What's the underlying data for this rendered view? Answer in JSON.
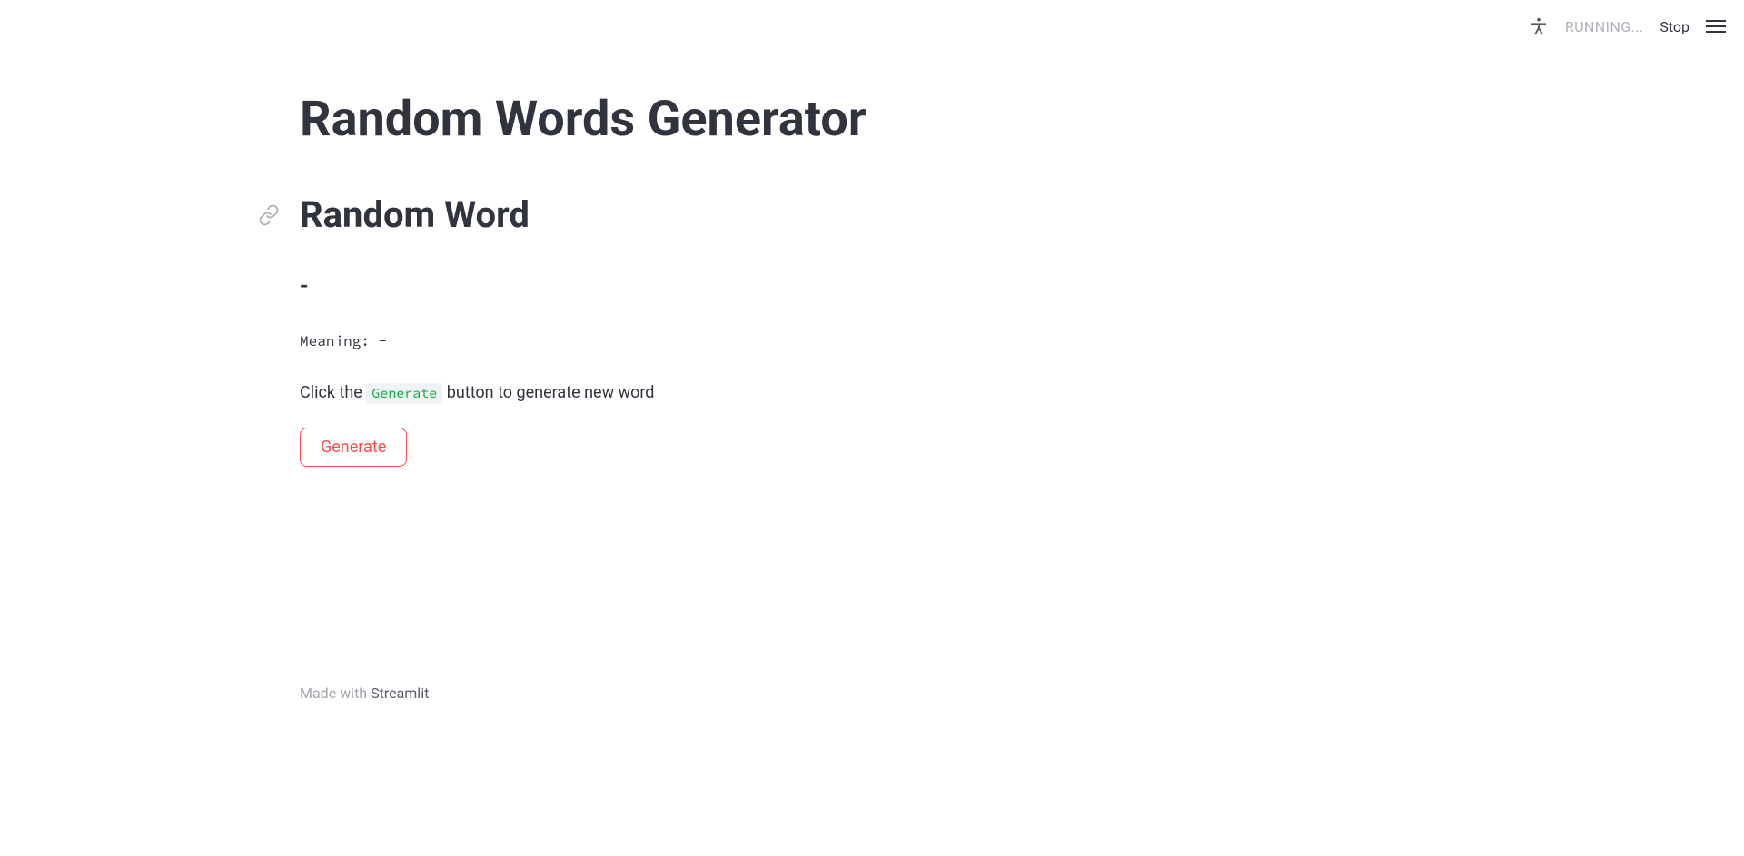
{
  "toolbar": {
    "running_label": "RUNNING...",
    "stop_label": "Stop"
  },
  "main": {
    "title": "Random Words Generator",
    "section_title": "Random Word",
    "word": "-",
    "meaning_label": "Meaning: -",
    "hint_prefix": "Click the ",
    "hint_code": "Generate",
    "hint_suffix": " button to generate new word",
    "generate_button": "Generate"
  },
  "footer": {
    "made_with": "Made with ",
    "brand": "Streamlit"
  }
}
